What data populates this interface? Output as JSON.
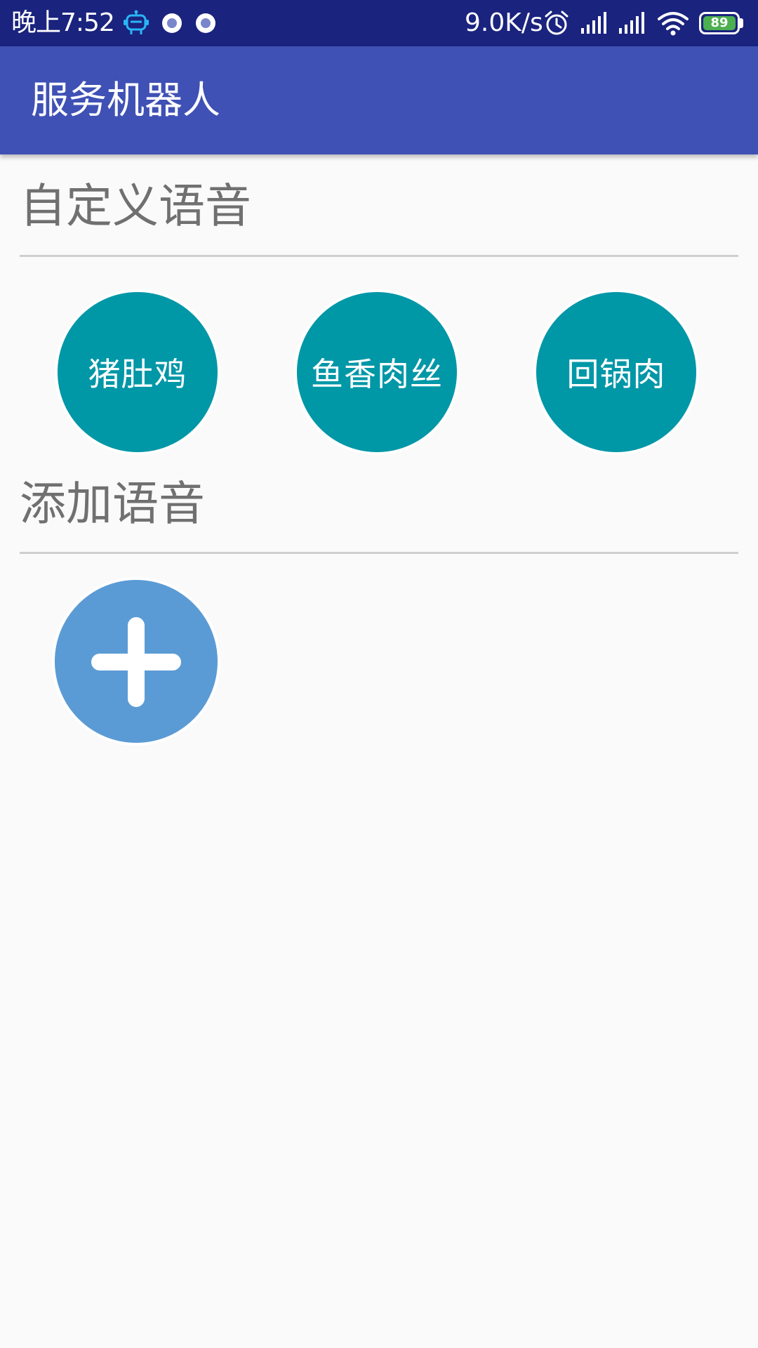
{
  "status_bar": {
    "time": "晚上7:52",
    "network_speed": "9.0K/s",
    "battery_level": "89",
    "icons": [
      "robot-icon",
      "record-icon",
      "record-icon",
      "alarm-icon",
      "signal-icon",
      "signal-icon",
      "wifi-icon",
      "battery-icon"
    ],
    "battery_color": "#4caf50"
  },
  "app_bar": {
    "title": "服务机器人",
    "color": "#3f51b5"
  },
  "custom_voice": {
    "title": "自定义语音",
    "buttons": [
      "猪肚鸡",
      "鱼香肉丝",
      "回锅肉"
    ],
    "button_color": "#0097a7"
  },
  "add_voice": {
    "title": "添加语音",
    "button_icon": "plus-icon",
    "button_color": "#5b9bd5"
  }
}
